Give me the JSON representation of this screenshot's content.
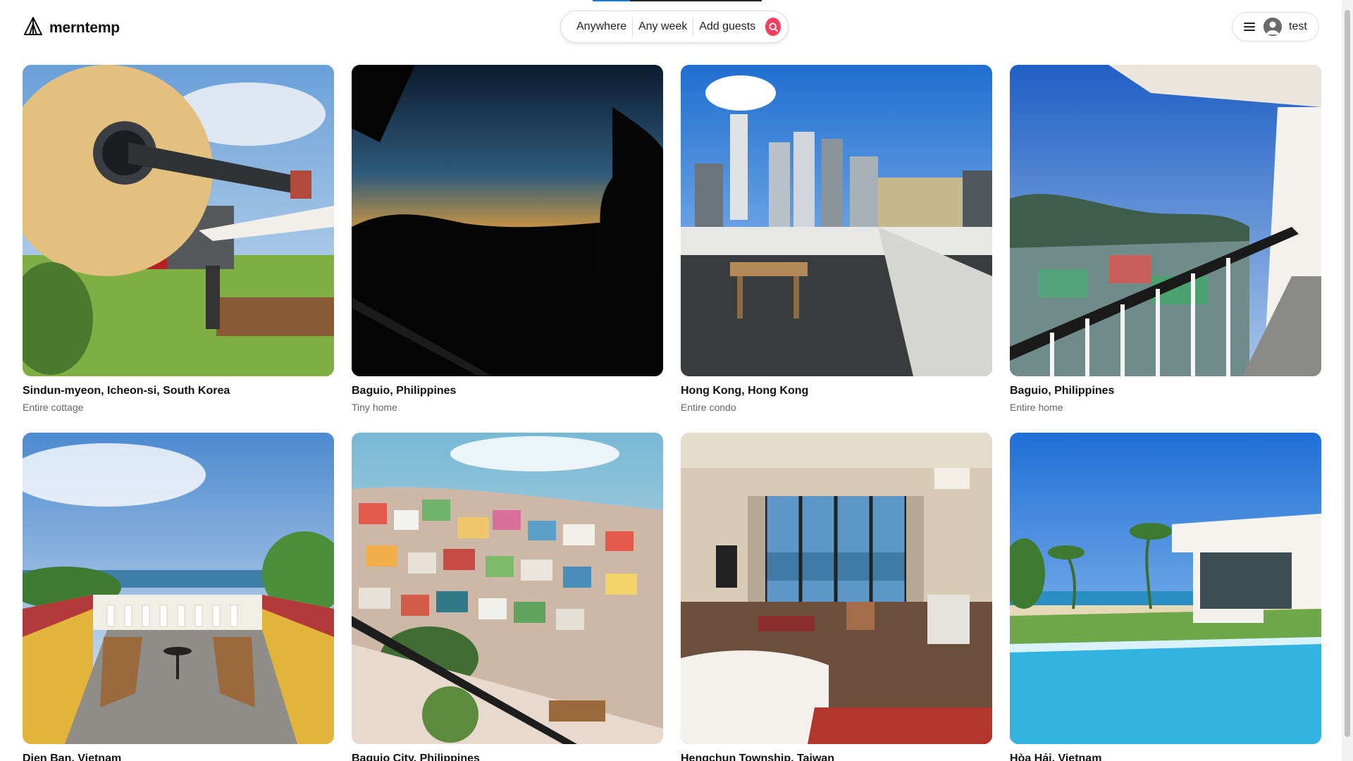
{
  "progress": {
    "fraction": 0.22,
    "color": "#1f77d4"
  },
  "brand": {
    "name": "merntemp",
    "icon": "a-frame-tent-icon"
  },
  "search": {
    "location": "Anywhere",
    "dates": "Any week",
    "guests": "Add guests",
    "button_icon": "search-icon",
    "accent": "#f43f5e"
  },
  "user": {
    "name": "test",
    "menu_icon": "hamburger-icon",
    "avatar_icon": "user-avatar-icon"
  },
  "listings": [
    {
      "location": "Sindun-myeon, Icheon-si, South Korea",
      "type": "Entire cottage"
    },
    {
      "location": "Baguio, Philippines",
      "type": "Tiny home"
    },
    {
      "location": "Hong Kong, Hong Kong",
      "type": "Entire condo"
    },
    {
      "location": "Baguio, Philippines",
      "type": "Entire home"
    },
    {
      "location": "Dien Ban, Vietnam",
      "type": ""
    },
    {
      "location": "Baguio City, Philippines",
      "type": ""
    },
    {
      "location": "Hengchun Township, Taiwan",
      "type": ""
    },
    {
      "location": "Hòa Hải, Vietnam",
      "type": ""
    }
  ]
}
